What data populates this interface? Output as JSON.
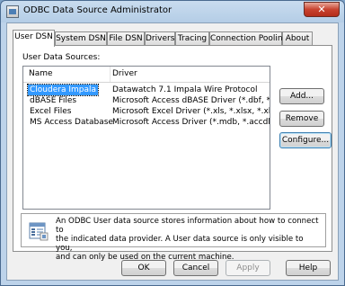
{
  "window": {
    "title": "ODBC Data Source Administrator",
    "close_glyph": "✕"
  },
  "tabs": [
    {
      "label": "User DSN",
      "active": true
    },
    {
      "label": "System DSN"
    },
    {
      "label": "File DSN"
    },
    {
      "label": "Drivers"
    },
    {
      "label": "Tracing"
    },
    {
      "label": "Connection Pooling"
    },
    {
      "label": "About"
    }
  ],
  "user_dsn": {
    "section_label": "User Data Sources:",
    "columns": {
      "name": "Name",
      "driver": "Driver"
    },
    "rows": [
      {
        "name": "Cloudera Impala",
        "driver": "Datawatch 7.1 Impala Wire Protocol",
        "selected": true
      },
      {
        "name": "dBASE Files",
        "driver": "Microsoft Access dBASE Driver (*.dbf, *.ndx"
      },
      {
        "name": "Excel Files",
        "driver": "Microsoft Excel Driver (*.xls, *.xlsx, *.xlsm, *.x"
      },
      {
        "name": "MS Access Database",
        "driver": "Microsoft Access Driver (*.mdb, *.accdb)"
      }
    ],
    "buttons": {
      "add": "Add...",
      "remove": "Remove",
      "configure": "Configure..."
    },
    "info_text": "An ODBC User data source stores information about how to connect to\nthe indicated data provider.  A User data source is only visible to you,\nand can only be used on the current machine."
  },
  "footer": {
    "ok": "OK",
    "cancel": "Cancel",
    "apply": "Apply",
    "help": "Help"
  }
}
